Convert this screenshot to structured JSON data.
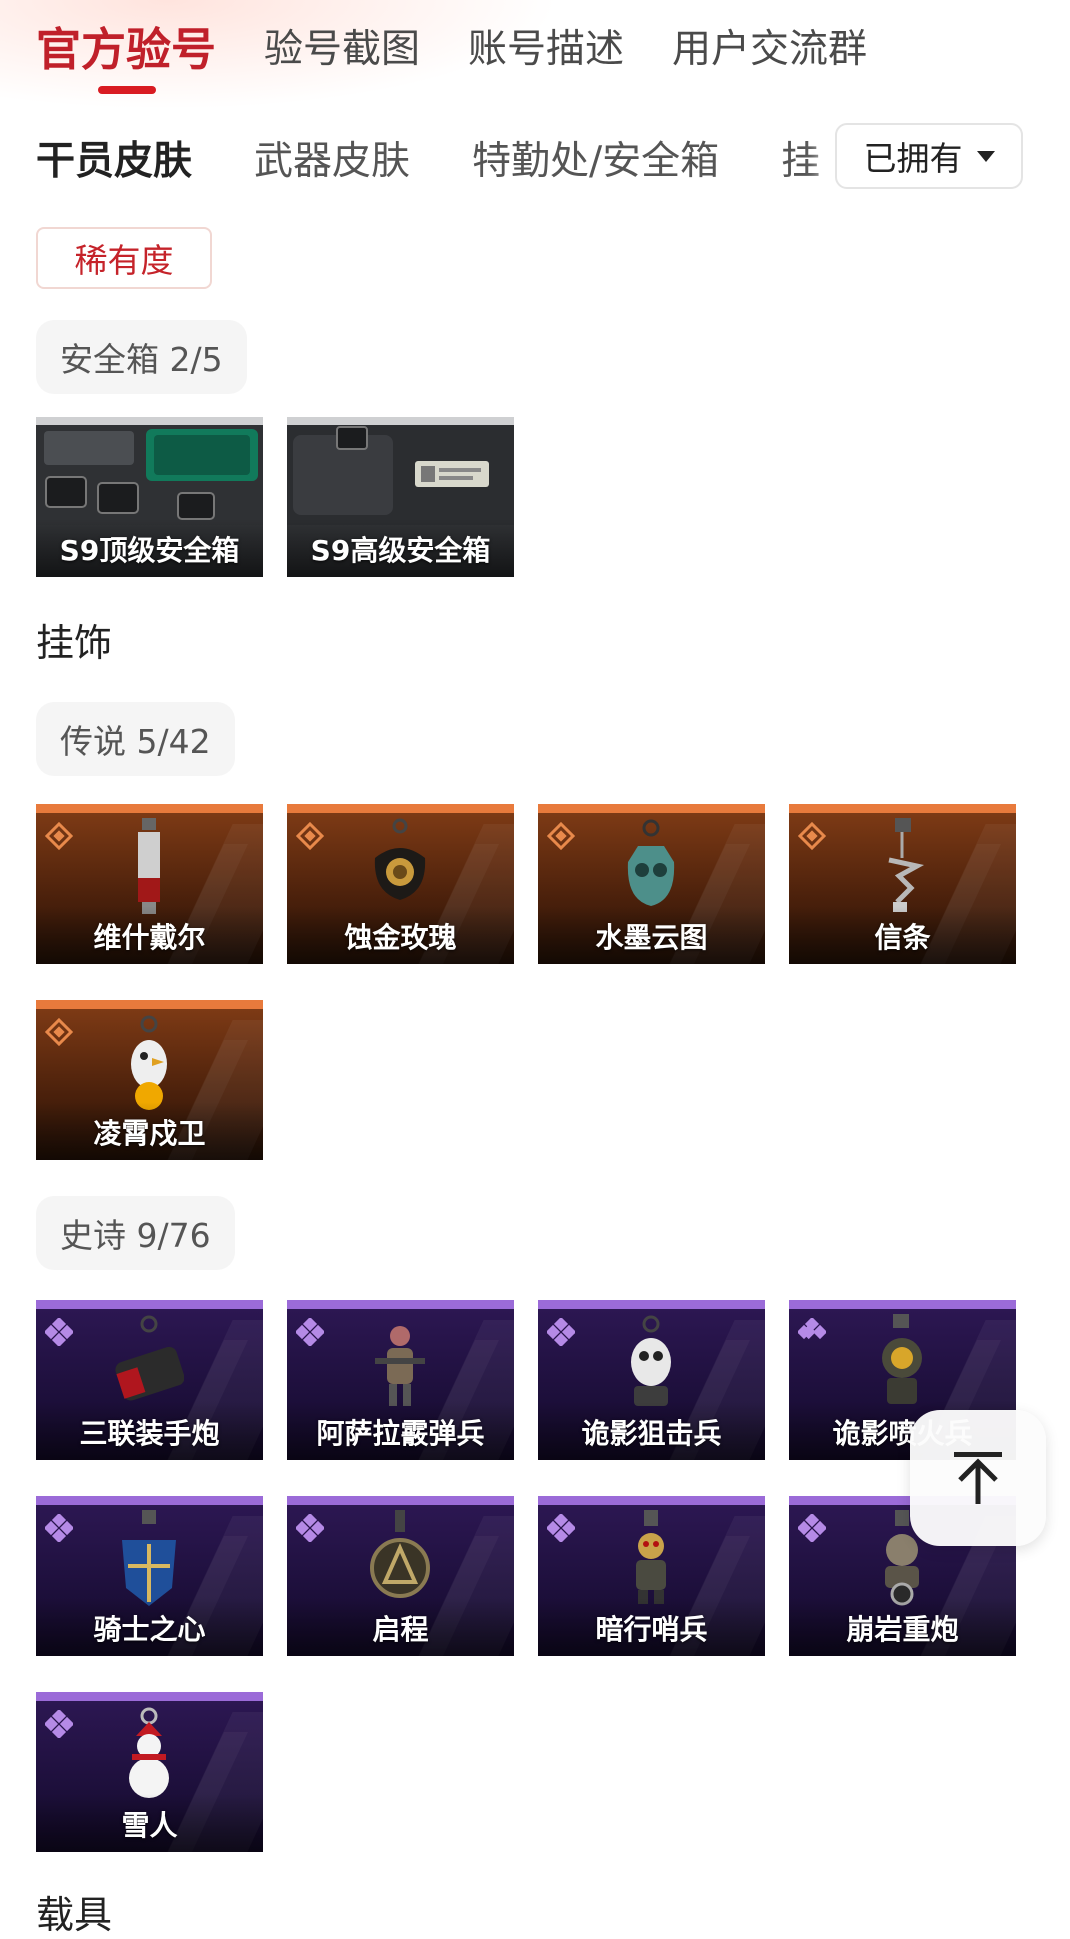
{
  "main_tabs": [
    {
      "label": "官方验号",
      "active": true
    },
    {
      "label": "验号截图",
      "active": false
    },
    {
      "label": "账号描述",
      "active": false
    },
    {
      "label": "用户交流群",
      "active": false
    }
  ],
  "category_tabs": [
    {
      "label": "干员皮肤",
      "active": true
    },
    {
      "label": "武器皮肤",
      "active": false
    },
    {
      "label": "特勤处/安全箱",
      "active": false
    },
    {
      "label": "挂",
      "active": false
    }
  ],
  "owned_filter": {
    "label": "已拥有"
  },
  "rarity_filter": {
    "label": "稀有度"
  },
  "colors": {
    "accent": "#d91b22",
    "legend": "#e87a3c",
    "epic": "#9b6bd8"
  },
  "safebox_section": {
    "chip": "安全箱 2/5",
    "items": [
      {
        "name": "S9顶级安全箱"
      },
      {
        "name": "S9高级安全箱"
      }
    ]
  },
  "pendant_heading": "挂饰",
  "legend_section": {
    "chip": "传说 5/42",
    "items": [
      {
        "name": "维什戴尔"
      },
      {
        "name": "蚀金玫瑰"
      },
      {
        "name": "水墨云图"
      },
      {
        "name": "信条"
      },
      {
        "name": "凌霄戍卫"
      }
    ]
  },
  "epic_section": {
    "chip": "史诗 9/76",
    "items": [
      {
        "name": "三联装手炮"
      },
      {
        "name": "阿萨拉霰弹兵"
      },
      {
        "name": "诡影狙击兵"
      },
      {
        "name": "诡影喷火兵"
      },
      {
        "name": "骑士之心"
      },
      {
        "name": "启程"
      },
      {
        "name": "暗行哨兵"
      },
      {
        "name": "崩岩重炮"
      },
      {
        "name": "雪人"
      }
    ]
  },
  "vehicle_heading": "载具",
  "back_to_top_icon": "arrow-up-icon"
}
